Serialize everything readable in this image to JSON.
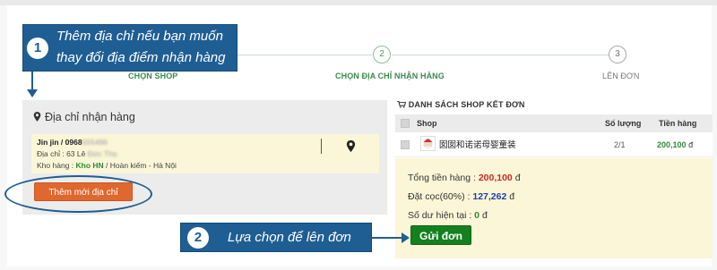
{
  "callouts": {
    "one": {
      "number": "1",
      "line1": "Thêm địa chỉ nếu bạn muốn",
      "line2": "thay đổi địa điểm nhận hàng"
    },
    "two": {
      "number": "2",
      "text": "Lựa chọn để lên đơn"
    }
  },
  "steps": [
    {
      "number": "1",
      "label": "CHỌN SHOP"
    },
    {
      "number": "2",
      "label": "CHỌN ĐỊA CHỈ NHẬN HÀNG"
    },
    {
      "number": "3",
      "label": "LÊN ĐƠN"
    }
  ],
  "address": {
    "title": "Địa chỉ nhận hàng",
    "name_phone": "Jin jin / 0968",
    "phone_hidden": "555496",
    "address_label": "Địa chỉ : 63 Lê",
    "address_hidden": "Đức Thọ",
    "warehouse_label": "Kho hàng :",
    "warehouse_value": "Kho HN",
    "warehouse_district": "/ Hoàn kiếm - Hà Nội",
    "add_button": "Thêm mới địa chỉ"
  },
  "shop_list": {
    "title": "DANH SÁCH SHOP KẾT ĐƠN",
    "columns": {
      "shop": "Shop",
      "qty": "Số lượng",
      "price": "Tiền hàng"
    },
    "rows": [
      {
        "shop_name": "囡囡和诺诺母婴童装",
        "qty": "2/1",
        "price": "200,100",
        "currency": "đ"
      }
    ]
  },
  "summary": {
    "total_label": "Tổng tiền hàng :",
    "total_value": "200,100",
    "deposit_label": "Đặt cọc(60%) :",
    "deposit_value": "127,262",
    "balance_label": "Số dư hiện tại :",
    "balance_value": "0",
    "currency": "đ",
    "submit_button": "Gửi đơn"
  },
  "colors": {
    "accent_blue": "#1f5e93",
    "green": "#2d8a38",
    "orange_button": "#e0672e",
    "red_total": "#d0281f",
    "blue_deposit": "#1d3fb0"
  }
}
